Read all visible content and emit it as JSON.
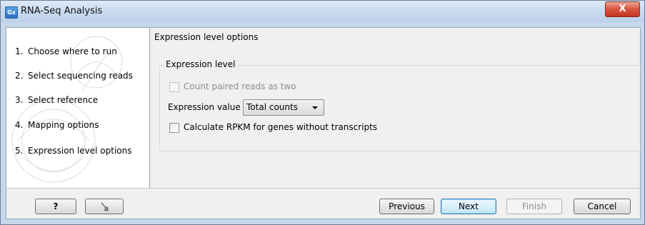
{
  "window": {
    "app_icon": "Gx",
    "title": "RNA-Seq Analysis",
    "close_label": "X"
  },
  "steps": [
    {
      "num": "1.",
      "label": "Choose where to run"
    },
    {
      "num": "2.",
      "label": "Select sequencing reads"
    },
    {
      "num": "3.",
      "label": "Select reference"
    },
    {
      "num": "4.",
      "label": "Mapping options"
    },
    {
      "num": "5.",
      "label": "Expression level options"
    }
  ],
  "panel": {
    "title": "Expression level options",
    "group_title": "Expression level",
    "count_paired": {
      "label": "Count paired reads as two",
      "checked": false,
      "enabled": false
    },
    "expression_value": {
      "label": "Expression value",
      "selected": "Total counts"
    },
    "calc_rpkm": {
      "label": "Calculate RPKM for genes without transcripts",
      "checked": false,
      "enabled": true
    }
  },
  "footer": {
    "help_label": "?",
    "reset_icon": "reset-arrow-icon",
    "previous_label": "Previous",
    "next_label": "Next",
    "finish_label": "Finish",
    "cancel_label": "Cancel"
  }
}
